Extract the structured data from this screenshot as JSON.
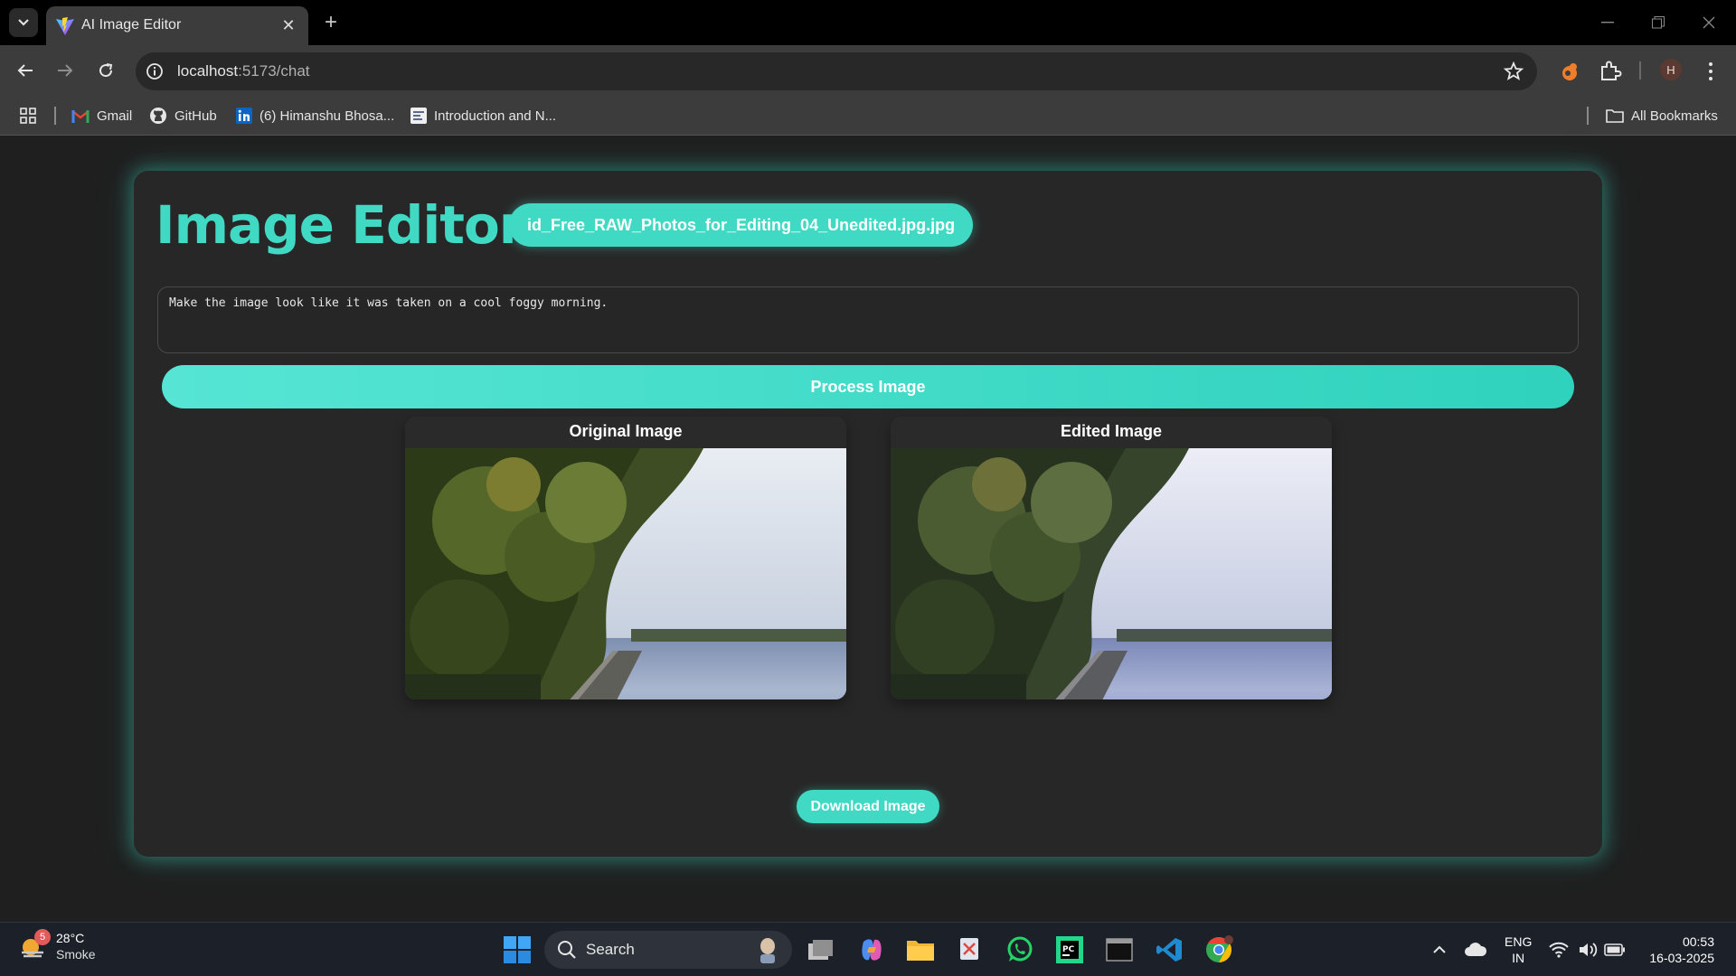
{
  "browser": {
    "tab_title": "AI Image Editor",
    "url_host": "localhost",
    "url_path": ":5173/chat",
    "bookmarks": [
      {
        "label": "Gmail",
        "icon": "gmail-icon"
      },
      {
        "label": "GitHub",
        "icon": "github-icon"
      },
      {
        "label": "(6) Himanshu Bhosa...",
        "icon": "linkedin-icon"
      },
      {
        "label": "Introduction and N...",
        "icon": "doc-icon"
      }
    ],
    "all_bookmarks": "All Bookmarks",
    "profile_initial": "H"
  },
  "editor": {
    "title": "Image Editor",
    "filename": "id_Free_RAW_Photos_for_Editing_04_Unedited.jpg.jpg",
    "prompt": "Make the image look like it was taken on a cool foggy morning.",
    "process_label": "Process Image",
    "original_label": "Original Image",
    "edited_label": "Edited Image",
    "download_label": "Download Image",
    "accent": "#3fd9c4"
  },
  "taskbar": {
    "weather_badge": "5",
    "temperature": "28°C",
    "condition": "Smoke",
    "search_label": "Search",
    "lang_line1": "ENG",
    "lang_line2": "IN",
    "time": "00:53",
    "date": "16-03-2025"
  }
}
